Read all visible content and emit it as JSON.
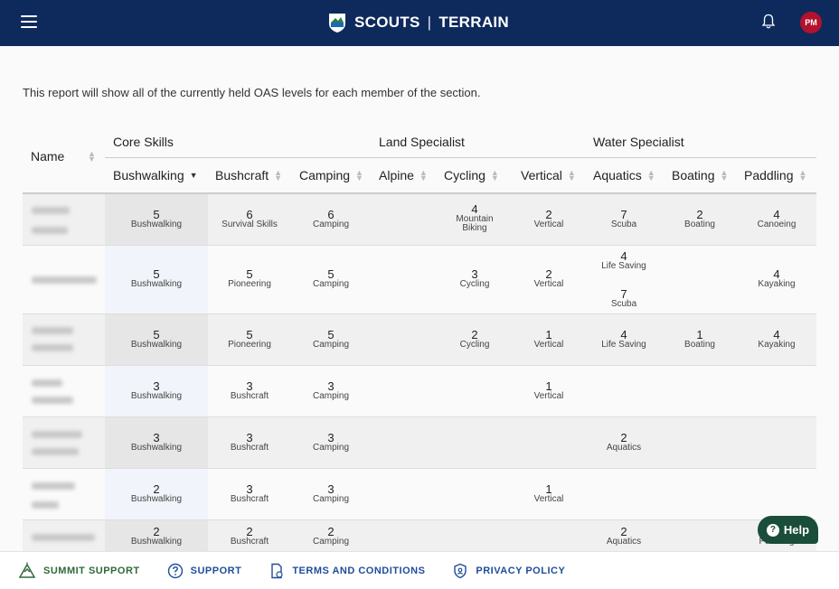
{
  "header": {
    "brand_left": "SCOUTS",
    "brand_sep": "|",
    "brand_right": "TERRAIN",
    "avatar_initials": "PM"
  },
  "intro": "This report will show all of the currently held OAS levels for each member of the section.",
  "groups": {
    "core": "Core Skills",
    "land": "Land Specialist",
    "water": "Water Specialist"
  },
  "columns": {
    "name": "Name",
    "bushwalking": "Bushwalking",
    "bushcraft": "Bushcraft",
    "camping": "Camping",
    "alpine": "Alpine",
    "cycling": "Cycling",
    "vertical": "Vertical",
    "aquatics": "Aquatics",
    "boating": "Boating",
    "paddling": "Paddling"
  },
  "rows": [
    {
      "bushwalking": {
        "lvl": "5",
        "nm": "Bushwalking"
      },
      "bushcraft": {
        "lvl": "6",
        "nm": "Survival Skills"
      },
      "camping": {
        "lvl": "6",
        "nm": "Camping"
      },
      "cycling": {
        "lvl": "4",
        "nm": "Mountain",
        "nm2": "Biking"
      },
      "vertical": {
        "lvl": "2",
        "nm": "Vertical"
      },
      "aquatics": {
        "lvl": "7",
        "nm": "Scuba"
      },
      "boating": {
        "lvl": "2",
        "nm": "Boating"
      },
      "paddling": {
        "lvl": "4",
        "nm": "Canoeing"
      }
    },
    {
      "bushwalking": {
        "lvl": "5",
        "nm": "Bushwalking"
      },
      "bushcraft": {
        "lvl": "5",
        "nm": "Pioneering"
      },
      "camping": {
        "lvl": "5",
        "nm": "Camping"
      },
      "cycling": {
        "lvl": "3",
        "nm": "Cycling"
      },
      "vertical": {
        "lvl": "2",
        "nm": "Vertical"
      },
      "aquatics": {
        "lvl": "4",
        "nm": "Life Saving"
      },
      "aquatics2": {
        "lvl": "7",
        "nm": "Scuba"
      },
      "paddling": {
        "lvl": "4",
        "nm": "Kayaking"
      }
    },
    {
      "bushwalking": {
        "lvl": "5",
        "nm": "Bushwalking"
      },
      "bushcraft": {
        "lvl": "5",
        "nm": "Pioneering"
      },
      "camping": {
        "lvl": "5",
        "nm": "Camping"
      },
      "cycling": {
        "lvl": "2",
        "nm": "Cycling"
      },
      "vertical": {
        "lvl": "1",
        "nm": "Vertical"
      },
      "aquatics": {
        "lvl": "4",
        "nm": "Life Saving"
      },
      "boating": {
        "lvl": "1",
        "nm": "Boating"
      },
      "paddling": {
        "lvl": "4",
        "nm": "Kayaking"
      }
    },
    {
      "bushwalking": {
        "lvl": "3",
        "nm": "Bushwalking"
      },
      "bushcraft": {
        "lvl": "3",
        "nm": "Bushcraft"
      },
      "camping": {
        "lvl": "3",
        "nm": "Camping"
      },
      "vertical": {
        "lvl": "1",
        "nm": "Vertical"
      }
    },
    {
      "bushwalking": {
        "lvl": "3",
        "nm": "Bushwalking"
      },
      "bushcraft": {
        "lvl": "3",
        "nm": "Bushcraft"
      },
      "camping": {
        "lvl": "3",
        "nm": "Camping"
      },
      "aquatics": {
        "lvl": "2",
        "nm": "Aquatics"
      }
    },
    {
      "bushwalking": {
        "lvl": "2",
        "nm": "Bushwalking"
      },
      "bushcraft": {
        "lvl": "3",
        "nm": "Bushcraft"
      },
      "camping": {
        "lvl": "3",
        "nm": "Camping"
      },
      "vertical": {
        "lvl": "1",
        "nm": "Vertical"
      }
    },
    {
      "bushwalking": {
        "lvl": "2",
        "nm": "Bushwalking"
      },
      "bushcraft": {
        "lvl": "2",
        "nm": "Bushcraft"
      },
      "camping": {
        "lvl": "2",
        "nm": "Camping"
      },
      "aquatics": {
        "lvl": "2",
        "nm": "Aquatics"
      },
      "paddling": {
        "lvl": "",
        "nm": "Paddling"
      }
    }
  ],
  "help_label": "Help",
  "footer": {
    "summit": "SUMMIT SUPPORT",
    "support": "SUPPORT",
    "terms": "TERMS AND CONDITIONS",
    "privacy": "PRIVACY POLICY"
  }
}
